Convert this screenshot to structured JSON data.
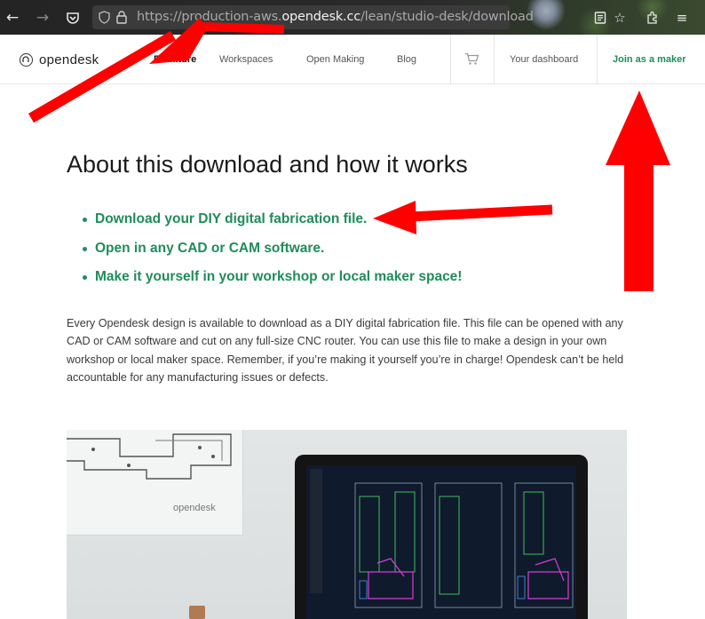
{
  "browser": {
    "url_prefix": "https://production-aws.",
    "url_domain": "opendesk.cc",
    "url_path": "/lean/studio-desk/download"
  },
  "header": {
    "logo_text": "opendesk",
    "nav": [
      "Furniture",
      "Workspaces",
      "Open Making",
      "Blog"
    ],
    "dashboard_label": "Your dashboard",
    "join_label": "Join as a maker"
  },
  "content": {
    "title": "About this download and how it works",
    "bullets": [
      "Download your DIY digital fabrication file.",
      "Open in any CAD or CAM software.",
      "Make it yourself in your workshop or local maker space!"
    ],
    "paragraph": "Every Opendesk design is available to download as a DIY digital fabrication file. This file can be opened with any CAD or CAM software and cut on any full-size CNC router. You can use this file to make a design in your own workshop or local maker space. Remember, if you’re making it yourself you’re in charge! Opendesk can’t be held accountable for any manufacturing issues or defects."
  },
  "photo": {
    "poster_text": "opendesk"
  },
  "colors": {
    "accent": "#1f8c5a",
    "annotation": "#ff0000"
  }
}
